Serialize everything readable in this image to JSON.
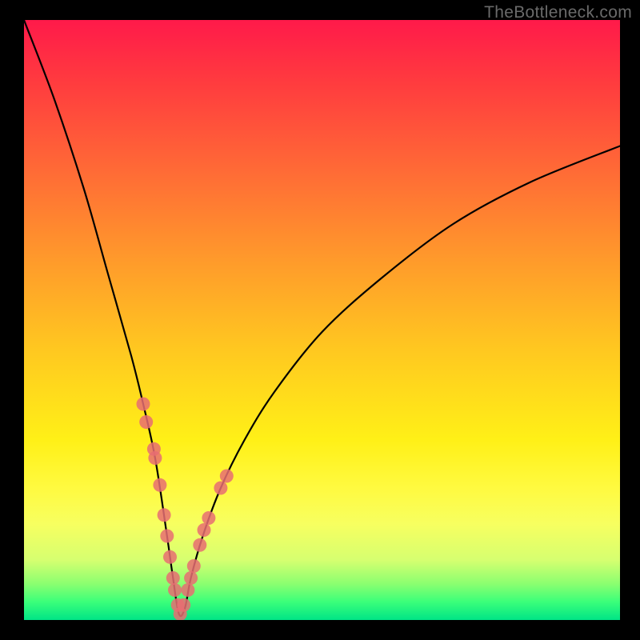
{
  "watermark": "TheBottleneck.com",
  "colors": {
    "frame": "#000000",
    "curve": "#000000",
    "dot": "#e86d72",
    "gradient_top": "#ff1a4a",
    "gradient_bottom": "#00e486"
  },
  "chart_data": {
    "type": "line",
    "title": "",
    "xlabel": "",
    "ylabel": "",
    "xlim": [
      0,
      100
    ],
    "ylim": [
      0,
      100
    ],
    "description": "V-shaped bottleneck curve on rainbow background. Minimum (optimal / zero-bottleneck) occurs around x≈26. Height encodes bottleneck percentage; green region at bottom ≈ 0%, red top ≈ 100%.",
    "series": [
      {
        "name": "bottleneck-curve",
        "x": [
          0,
          5,
          10,
          14,
          18,
          20,
          22,
          24,
          25,
          26,
          27,
          28,
          30,
          33,
          37,
          42,
          50,
          60,
          72,
          85,
          100
        ],
        "values": [
          100,
          87,
          72,
          58,
          44,
          36,
          27,
          14,
          7,
          1,
          2,
          7,
          14,
          22,
          30,
          38,
          48,
          57,
          66,
          73,
          79
        ]
      }
    ],
    "highlighted_points_left": {
      "name": "recommendations-left-branch",
      "x": [
        20.0,
        20.5,
        21.8,
        22.0,
        22.8,
        23.5,
        24.0,
        24.5,
        25.0,
        25.3,
        25.8,
        26.2
      ],
      "values": [
        36.0,
        33.0,
        28.5,
        27.0,
        22.5,
        17.5,
        14.0,
        10.5,
        7.0,
        5.0,
        2.5,
        1.0
      ]
    },
    "highlighted_points_right": {
      "name": "recommendations-right-branch",
      "x": [
        26.8,
        27.5,
        28.0,
        28.5,
        29.5,
        30.2,
        31.0,
        33.0,
        34.0
      ],
      "values": [
        2.5,
        5.0,
        7.0,
        9.0,
        12.5,
        15.0,
        17.0,
        22.0,
        24.0
      ]
    },
    "minimum": {
      "x": 26,
      "value": 1
    }
  }
}
